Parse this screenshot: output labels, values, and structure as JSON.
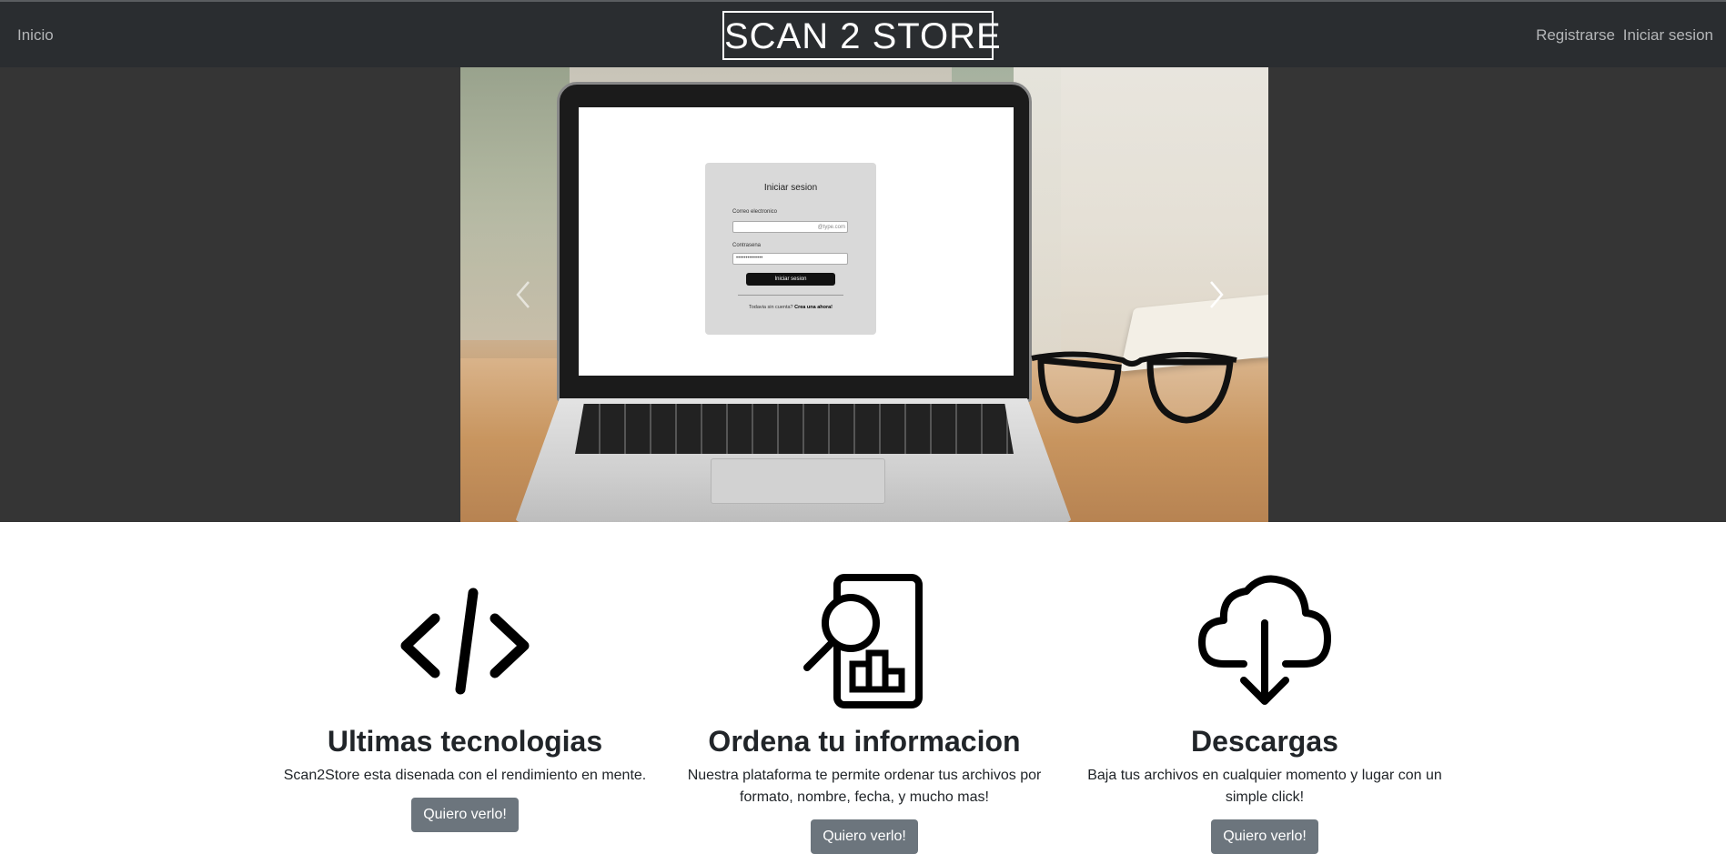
{
  "nav": {
    "home": "Inicio",
    "brand": "SCAN 2 STORE",
    "register": "Registrarse",
    "login": "Iniciar sesion"
  },
  "carousel": {
    "prev_icon": "chevron-left-icon",
    "next_icon": "chevron-right-icon",
    "slide_login": {
      "title": "Iniciar sesion",
      "email_label": "Correo electronico",
      "email_suffix": "@type.com",
      "password_label": "Contrasena",
      "password_value": "••••••••••••••",
      "button": "Iniciar sesion",
      "footer_text": "Todavia sin cuenta?",
      "footer_link": "Crea una ahora!"
    }
  },
  "features": [
    {
      "icon": "code-icon",
      "title": "Ultimas tecnologias",
      "text": "Scan2Store esta disenada con el rendimiento en mente.",
      "button": "Quiero verlo!"
    },
    {
      "icon": "document-search-chart-icon",
      "title": "Ordena tu informacion",
      "text": "Nuestra plataforma te permite ordenar tus archivos por formato, nombre, fecha, y mucho mas!",
      "button": "Quiero verlo!"
    },
    {
      "icon": "cloud-download-icon",
      "title": "Descargas",
      "text": "Baja tus archivos en cualquier momento y lugar con un simple click!",
      "button": "Quiero verlo!"
    }
  ],
  "colors": {
    "navbar_bg": "#2a2d30",
    "carousel_bg": "#353535",
    "button_bg": "#6c757d",
    "text": "#212529"
  }
}
